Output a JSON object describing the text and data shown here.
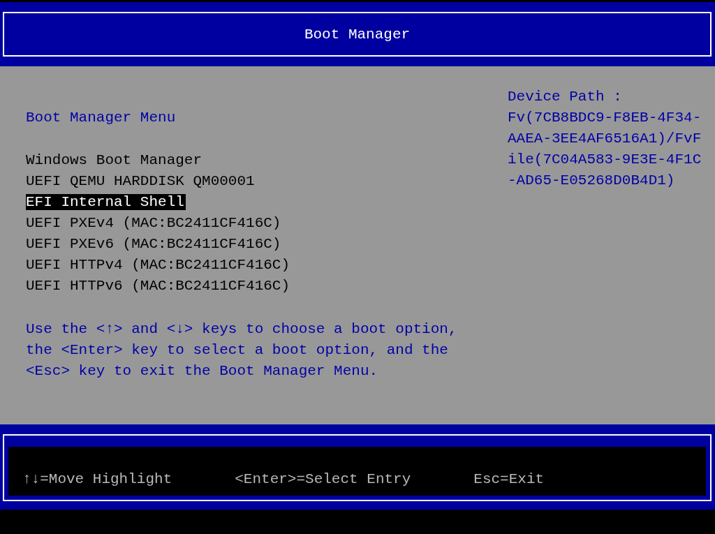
{
  "window": {
    "title": "Boot Manager"
  },
  "menu": {
    "title": "Boot Manager Menu",
    "entries": [
      {
        "label": "Windows Boot Manager",
        "selected": false
      },
      {
        "label": "UEFI QEMU HARDDISK QM00001",
        "selected": false
      },
      {
        "label": "EFI Internal Shell",
        "selected": true
      },
      {
        "label": "UEFI PXEv4 (MAC:BC2411CF416C)",
        "selected": false
      },
      {
        "label": "UEFI PXEv6 (MAC:BC2411CF416C)",
        "selected": false
      },
      {
        "label": "UEFI HTTPv4 (MAC:BC2411CF416C)",
        "selected": false
      },
      {
        "label": "UEFI HTTPv6 (MAC:BC2411CF416C)",
        "selected": false
      }
    ],
    "help": "Use the <↑> and <↓> keys to choose a boot option, the <Enter> key to select a boot option, and the <Esc> key to exit the Boot Manager Menu."
  },
  "device_path": {
    "label": "Device Path :",
    "value": "Fv(7CB8BDC9-F8EB-4F34-AAEA-3EE4AF6516A1)/FvFile(7C04A583-9E3E-4F1C-AD65-E05268D0B4D1)"
  },
  "status_bar": [
    "↑↓=Move Highlight",
    "<Enter>=Select Entry",
    "Esc=Exit"
  ]
}
